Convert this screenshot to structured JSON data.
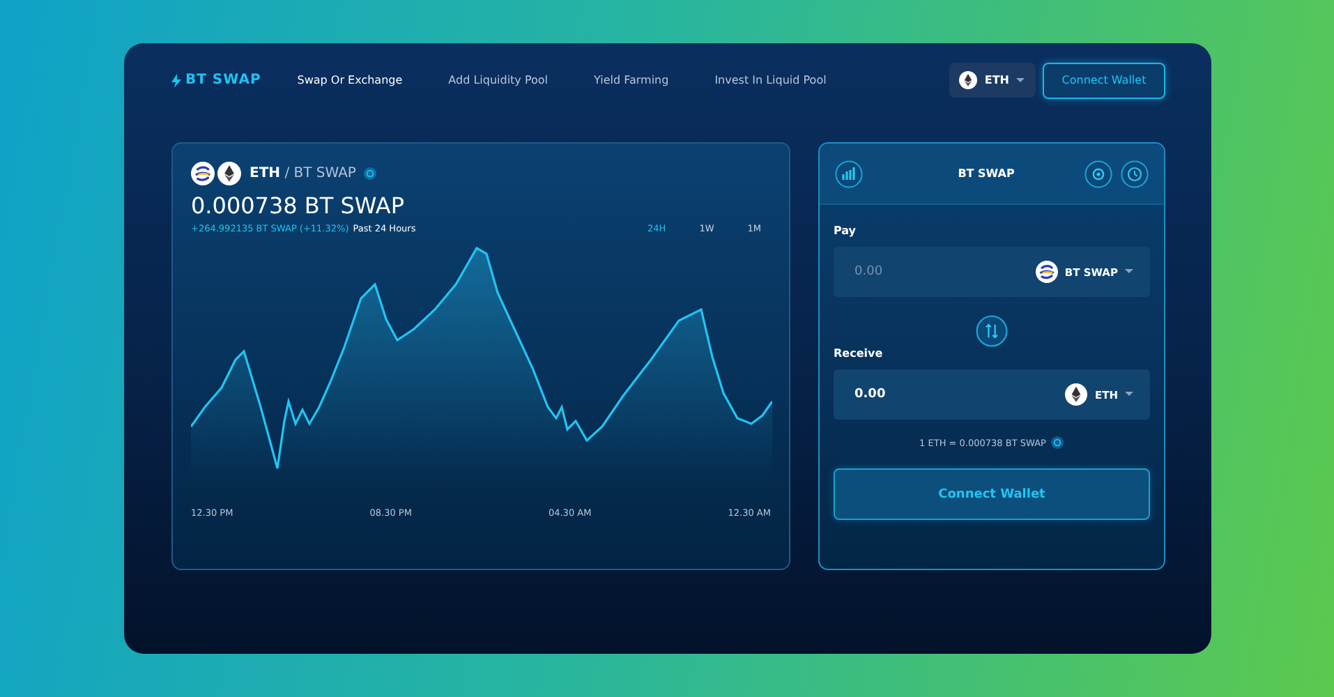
{
  "brand": {
    "name": "BT SWAP"
  },
  "nav": [
    {
      "label": "Swap Or Exchange",
      "selected": true
    },
    {
      "label": "Add Liquidity Pool",
      "selected": false
    },
    {
      "label": "Yield Farming",
      "selected": false
    },
    {
      "label": "Invest In Liquid Pool",
      "selected": false
    }
  ],
  "network": {
    "label": "ETH"
  },
  "header_button": "Connect Wallet",
  "chart_panel": {
    "pair": "**ETH** / BT SWAP",
    "price": "0.000738 BT SWAP",
    "change": "+264.992135 BT SWAP (+11.32%)",
    "period": "Past 24 Hours",
    "ranges": [
      {
        "label": "24H",
        "selected": true
      },
      {
        "label": "1W",
        "selected": false
      },
      {
        "label": "1M",
        "selected": false
      }
    ],
    "x_labels": [
      "12.30 PM",
      "08.30 PM",
      "04.30 AM",
      "12.30 AM"
    ]
  },
  "swap": {
    "title": "BT SWAP",
    "pay": {
      "label": "Pay",
      "placeholder": "0.00",
      "token": "BT SWAP",
      "kind": "bt"
    },
    "receive": {
      "label": "Receive",
      "value": "0.00",
      "token": "ETH",
      "kind": "eth"
    },
    "rate": "1 ETH = 0.000738 BT SWAP",
    "button": "Connect Wallet"
  }
}
